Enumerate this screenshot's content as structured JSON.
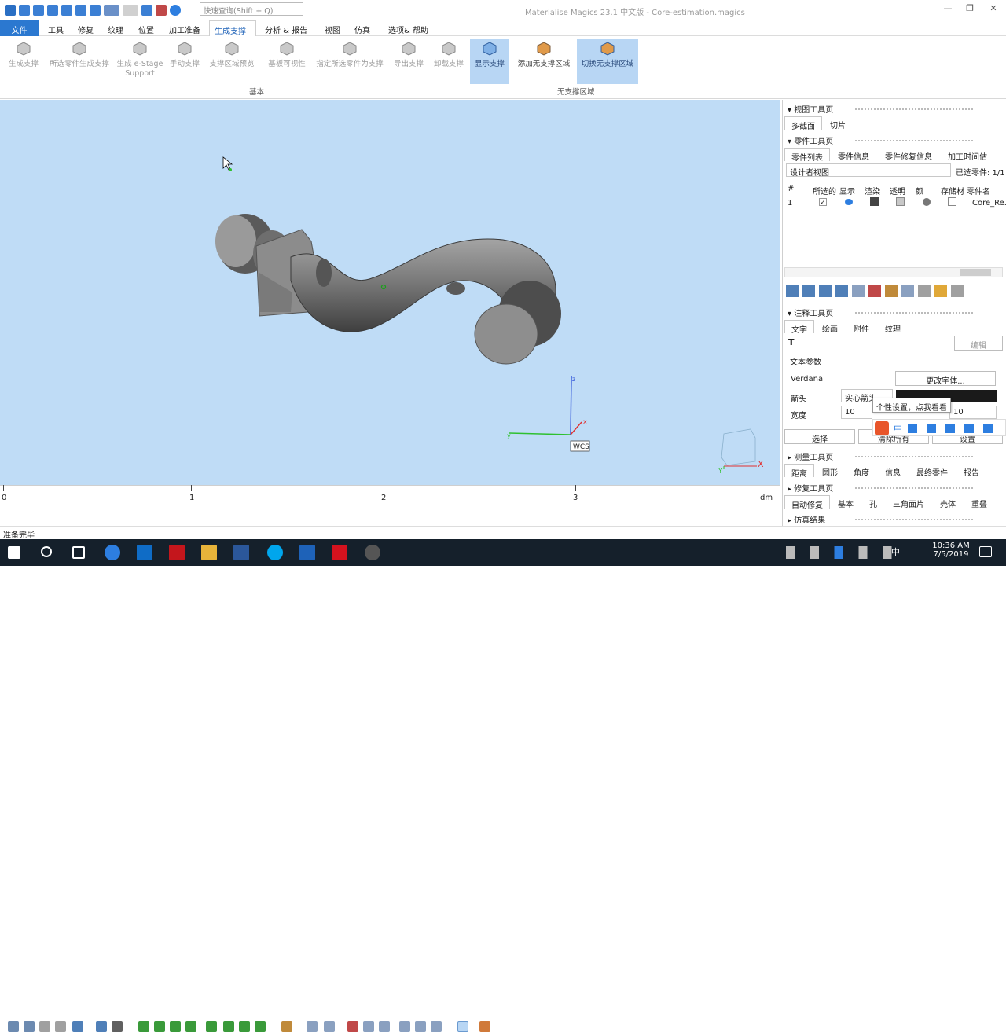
{
  "window": {
    "title": "Materialise Magics 23.1 中文版 - Core-estimation.magics",
    "search_placeholder": "快速查询(Shift + Q)"
  },
  "menu": [
    "文件",
    "工具",
    "修复",
    "纹理",
    "位置",
    "加工准备",
    "生成支撑",
    "分析 & 报告",
    "视图",
    "仿真",
    "选项& 帮助"
  ],
  "ribbon": {
    "basic_buttons": [
      "生成支撑",
      "所选零件生成支撑",
      "生成 e-Stage Support",
      "手动支撑",
      "支撑区域预览",
      "基板可视性",
      "指定所选零件为支撑",
      "导出支撑",
      "卸载支撑",
      "显示支撑"
    ],
    "group_basic": "基本",
    "nosupport_buttons": [
      "添加无支撑区域",
      "切换无支撑区域"
    ],
    "group_nosupport": "无支撑区域"
  },
  "viewport": {
    "wcs_label": "WCS",
    "axis_x": "x",
    "axis_y": "y",
    "axis_z": "z",
    "cube_x": "X",
    "cube_y": "Y"
  },
  "ruler": {
    "labels": [
      "0",
      "1",
      "2",
      "3"
    ],
    "unit": "dm"
  },
  "status": "准备完毕",
  "view_toolbar": {
    "title": "视图工具页",
    "tabs": [
      "多截面",
      "切片"
    ]
  },
  "parts_toolbar": {
    "title": "零件工具页",
    "tabs": [
      "零件列表",
      "零件信息",
      "零件修复信息",
      "加工时间估"
    ],
    "view_select": "设计者视图",
    "selected_count": "已选零件: 1/1",
    "columns": [
      "#",
      "所选的",
      "显示",
      "渲染",
      "透明",
      "颜",
      "存储材",
      "零件名"
    ],
    "rows": [
      {
        "num": "1",
        "name": "Core_Re..."
      }
    ]
  },
  "annotation_toolbar": {
    "title": "注释工具页",
    "tabs": [
      "文字",
      "绘画",
      "附件",
      "纹理"
    ],
    "text_tool": "T",
    "edit_btn": "编辑",
    "text_params": "文本参数",
    "font": "Verdana",
    "change_font": "更改字体...",
    "arrow_label": "箭头",
    "arrow_value": "实心箭头",
    "width_label": "宽度",
    "width_value": "10",
    "width_value2": "10",
    "select_btn": "选择",
    "clear_btn": "清除所有",
    "settings_btn": "设置"
  },
  "tooltip": "个性设置，点我看看",
  "measure_toolbar": {
    "title": "测量工具页",
    "tabs": [
      "距离",
      "圆形",
      "角度",
      "信息",
      "最终零件",
      "报告"
    ]
  },
  "repair_toolbar": {
    "title": "修复工具页",
    "tabs": [
      "自动修复",
      "基本",
      "孔",
      "三角面片",
      "壳体",
      "重叠"
    ]
  },
  "sim_results": {
    "title": "仿真结果"
  },
  "taskbar": {
    "time": "10:36 AM",
    "date": "7/5/2019",
    "ime": "中"
  }
}
